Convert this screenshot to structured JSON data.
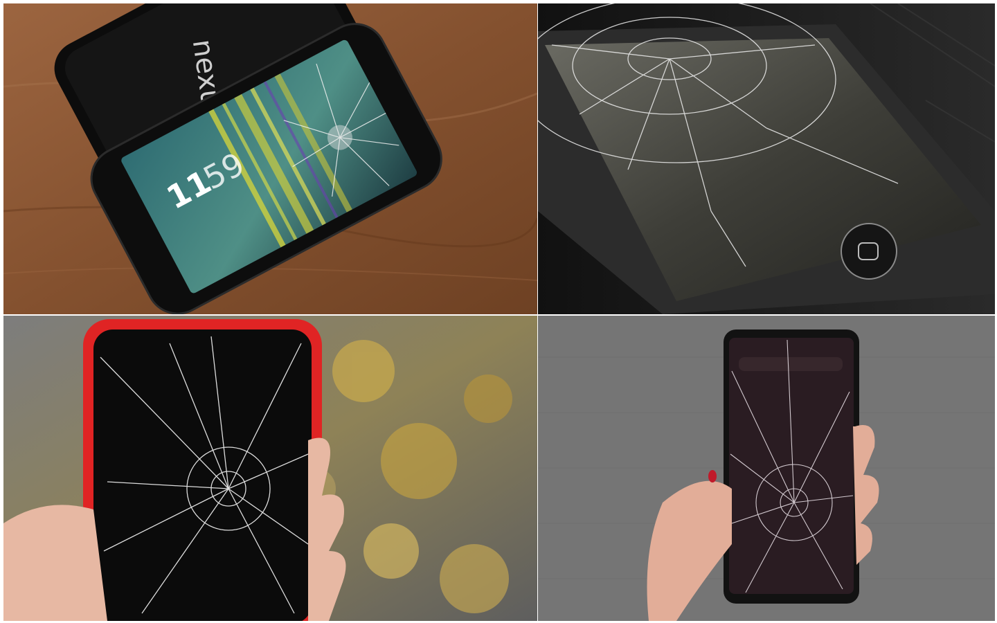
{
  "panels": [
    {
      "brand_text": "nexus",
      "clock_hour": "11",
      "clock_min": "59",
      "colors": {
        "table": "#8a5634",
        "phone": "#111111",
        "screen": "#3f7f7c",
        "glitch": "#d8d63a"
      }
    },
    {
      "colors": {
        "table": "#1b1b1b",
        "phone": "#262626",
        "glass": "#4a4a44",
        "crack": "#eeeeee"
      }
    },
    {
      "colors": {
        "background": "#6f6f6f",
        "case": "#e02424",
        "screen": "#0b0b0b",
        "skin": "#e7b8a3",
        "crack": "#f4f4f4"
      }
    },
    {
      "colors": {
        "wall": "#757575",
        "phone": "#121212",
        "screen": "#2a1c22",
        "skin": "#e2ad98",
        "crack": "#f0e8ee"
      }
    }
  ]
}
